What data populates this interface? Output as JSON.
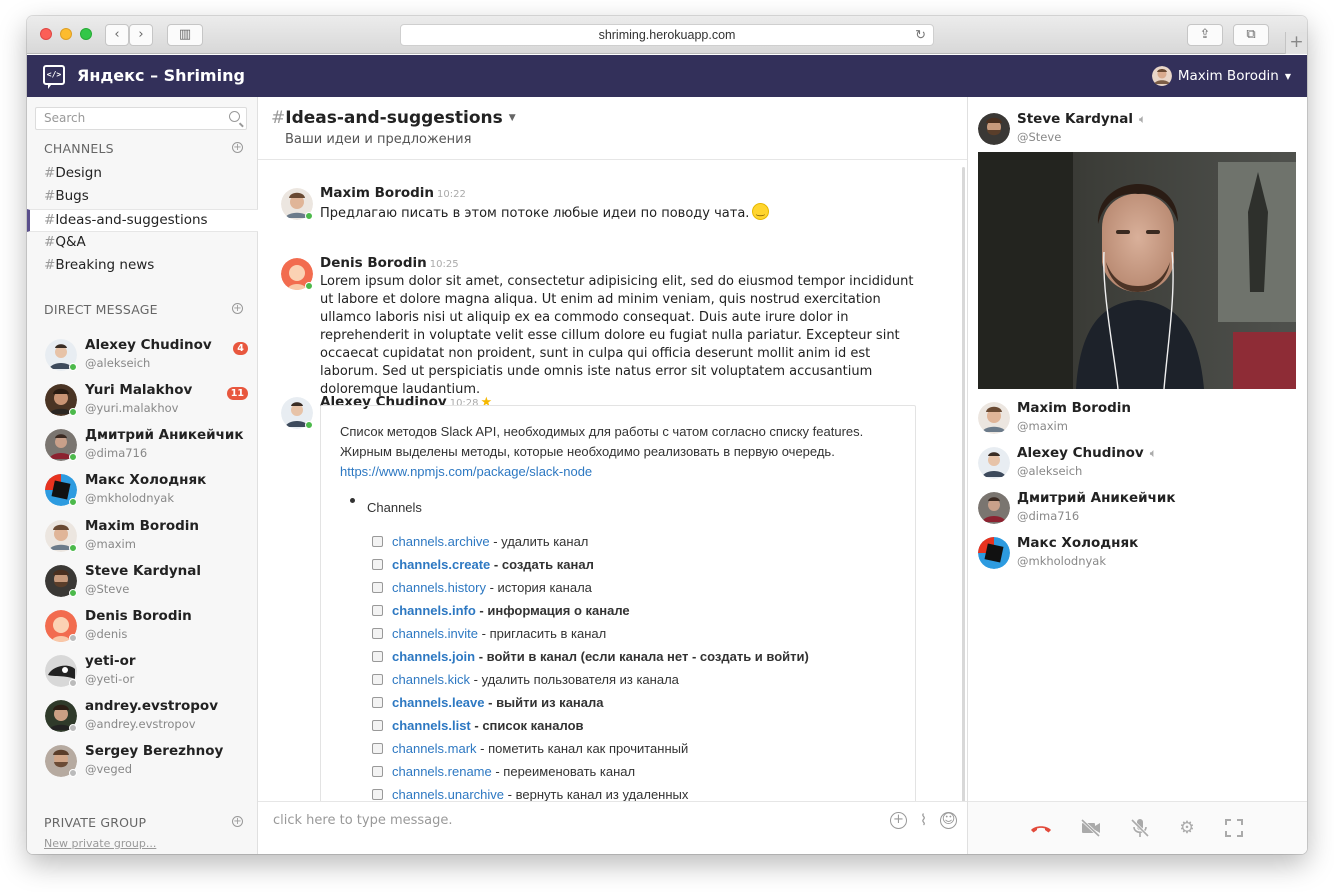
{
  "browser": {
    "url": "shriming.herokuapp.com",
    "back_icon": "chevron-left-icon",
    "forward_icon": "chevron-right-icon"
  },
  "app": {
    "title": "Яндекс – Shriming",
    "user_name": "Maxim Borodin"
  },
  "sidebar": {
    "search_placeholder": "Search",
    "channels_title": "CHANNELS",
    "channels": [
      {
        "name": "Design",
        "active": false
      },
      {
        "name": "Bugs",
        "active": false
      },
      {
        "name": "Ideas-and-suggestions",
        "active": true
      },
      {
        "name": "Q&A",
        "active": false
      },
      {
        "name": "Breaking news",
        "active": false
      }
    ],
    "dm_title": "DIRECT MESSAGE",
    "direct_messages": [
      {
        "name": "Alexey Chudinov",
        "username": "@alekseich",
        "badge": "4",
        "online": true
      },
      {
        "name": "Yuri Malakhov",
        "username": "@yuri.malakhov",
        "badge": "11",
        "online": true
      },
      {
        "name": "Дмитрий Аникейчик",
        "username": "@dima716",
        "badge": "",
        "online": true
      },
      {
        "name": "Макс Холодняк",
        "username": "@mkholodnyak",
        "badge": "",
        "online": true
      },
      {
        "name": "Maxim Borodin",
        "username": "@maxim",
        "badge": "",
        "online": true
      },
      {
        "name": "Steve Kardynal",
        "username": "@Steve",
        "badge": "",
        "online": true
      },
      {
        "name": "Denis Borodin",
        "username": "@denis",
        "badge": "",
        "online": false
      },
      {
        "name": "yeti-or",
        "username": "@yeti-or",
        "badge": "",
        "online": false
      },
      {
        "name": "andrey.evstropov",
        "username": "@andrey.evstropov",
        "badge": "",
        "online": false
      },
      {
        "name": "Sergey Berezhnoy",
        "username": "@veged",
        "badge": "",
        "online": false
      }
    ],
    "private_title": "PRIVATE GROUP",
    "new_private": "New private group..."
  },
  "channel": {
    "name": "Ideas-and-suggestions",
    "description": "Ваши идеи и предложения"
  },
  "messages": [
    {
      "author": "Maxim Borodin",
      "time": "10:22",
      "text": "Предлагаю писать в этом потоке любые идеи по поводу чата."
    },
    {
      "author": "Denis Borodin",
      "time": "10:25",
      "text": "Lorem ipsum dolor sit amet, consectetur adipisicing elit, sed do eiusmod tempor incididunt ut labore et dolore magna aliqua. Ut enim ad minim veniam, quis nostrud exercitation ullamco laboris nisi ut aliquip ex ea commodo consequat. Duis aute irure dolor in reprehenderit in voluptate velit esse cillum dolore eu fugiat nulla pariatur. Excepteur sint occaecat cupidatat non proident, sunt in culpa qui officia deserunt mollit anim id est laborum. Sed ut perspiciatis unde omnis iste natus error sit voluptatem accusantium doloremque laudantium."
    },
    {
      "author": "Alexey Chudinov",
      "time": "10:28",
      "starred": true
    }
  ],
  "attachment": {
    "line1": "Список методов Slack API, необходимых для работы с чатом согласно списку features.",
    "line2": "Жирным выделены методы, которые необходимо реализовать в первую очередь.",
    "link": "https://www.npmjs.com/package/slack-node",
    "section": "Channels",
    "methods": [
      {
        "method": "channels.archive",
        "desc": "- удалить канал",
        "bold": false
      },
      {
        "method": "channels.create",
        "desc": "- создать канал",
        "bold": true
      },
      {
        "method": "channels.history",
        "desc": "- история канала",
        "bold": false
      },
      {
        "method": "channels.info",
        "desc": "- информация о канале",
        "bold": true
      },
      {
        "method": "channels.invite",
        "desc": "- пригласить в канал",
        "bold": false
      },
      {
        "method": "channels.join",
        "desc": "- войти в канал (если канала нет - создать и войти)",
        "bold": true
      },
      {
        "method": "channels.kick",
        "desc": "- удалить пользователя из канала",
        "bold": false
      },
      {
        "method": "channels.leave",
        "desc": "- выйти из канала",
        "bold": true
      },
      {
        "method": "channels.list",
        "desc": "- список каналов",
        "bold": true
      },
      {
        "method": "channels.mark",
        "desc": "- пометить канал как прочитанный",
        "bold": false
      },
      {
        "method": "channels.rename",
        "desc": "- переименовать канал",
        "bold": false
      },
      {
        "method": "channels.unarchive",
        "desc": "- вернуть канал из удаленных",
        "bold": false
      }
    ]
  },
  "composer": {
    "placeholder": "click here to type message."
  },
  "call": {
    "speaker": {
      "name": "Steve Kardynal",
      "username": "@Steve"
    },
    "participants": [
      {
        "name": "Maxim Borodin",
        "username": "@maxim",
        "speaking": false
      },
      {
        "name": "Alexey Chudinov",
        "username": "@alekseich",
        "speaking": true
      },
      {
        "name": "Дмитрий Аникейчик",
        "username": "@dima716",
        "speaking": false
      },
      {
        "name": "Макс Холодняк",
        "username": "@mkholodnyak",
        "speaking": false
      }
    ],
    "controls": [
      "hangup-icon",
      "camera-off-icon",
      "mic-off-icon",
      "settings-icon",
      "fullscreen-icon"
    ]
  },
  "colors": {
    "header": "#33305a",
    "link": "#2d78c2",
    "badge": "#e8573e",
    "online": "#4cb94b",
    "hangup": "#e24a3b"
  }
}
